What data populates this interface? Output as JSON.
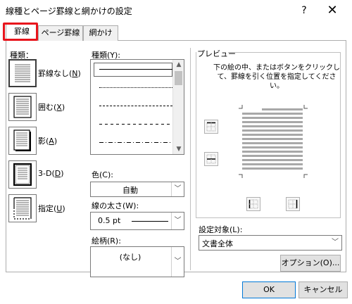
{
  "window": {
    "title": "線種とページ罫線と網かけの設定",
    "help": "?",
    "close": "✕"
  },
  "tabs": [
    {
      "label": "罫線",
      "active": true
    },
    {
      "label": "ページ罫線",
      "active": false
    },
    {
      "label": "網かけ",
      "active": false
    }
  ],
  "highlight_color": "#e8141c",
  "type": {
    "label": "種類：",
    "items": [
      {
        "label": "罫線なし(",
        "key": "N",
        "close": ")",
        "selected": true
      },
      {
        "label": "囲む(",
        "key": "X",
        "close": ")",
        "selected": false
      },
      {
        "label": "影(",
        "key": "A",
        "close": ")",
        "selected": false
      },
      {
        "label": "3-D(",
        "key": "D",
        "close": ")",
        "selected": false
      },
      {
        "label": "指定(",
        "key": "U",
        "close": ")",
        "selected": false
      }
    ]
  },
  "style": {
    "label": "種類(Y):",
    "lines": [
      "solid",
      "dotted-fine",
      "dashed-fine",
      "dashed",
      "dash-dot"
    ],
    "selected_index": 0
  },
  "color": {
    "label": "色(C):",
    "value": "自動"
  },
  "width": {
    "label": "線の太さ(W):",
    "value": "0.5 pt"
  },
  "art": {
    "label": "絵柄(R):",
    "value": "(なし)"
  },
  "preview": {
    "label": "プレビュー",
    "help": "下の絵の中、またはボタンをクリックして、罫線を引く位置を指定してください。"
  },
  "apply_to": {
    "label": "設定対象(L):",
    "value": "文書全体"
  },
  "buttons": {
    "options": "オプション(O)...",
    "ok": "OK",
    "cancel": "キャンセル"
  }
}
